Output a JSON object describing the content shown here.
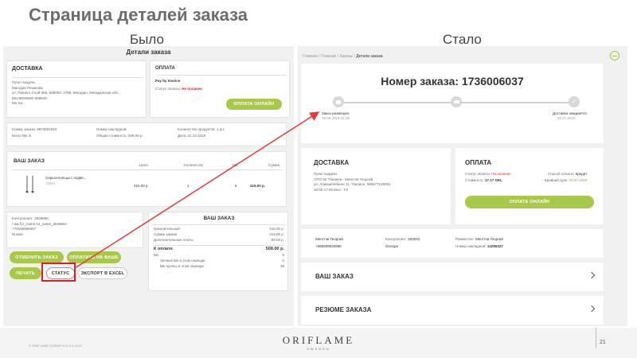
{
  "slide": {
    "title": "Страница деталей заказа",
    "before_label": "Было",
    "after_label": "Стало",
    "page_number": "21",
    "copyright": "© ORIFLAME COSMETICS S.A 2019",
    "logo": "ORIFLAME",
    "logo_sub": "SWEDEN"
  },
  "before": {
    "page_title": "Детали заказа",
    "delivery": {
      "title": "ДОСТАВКА",
      "lines": [
        "Пункт выдачи",
        "Магадан Резанова",
        "ул. Пешего 3 кой-356, 685000, 2768, Магадан, Магаданская обл...",
        "89148006890 898849",
        "Mo-Sa"
      ]
    },
    "payment": {
      "title": "ОПЛАТА",
      "method": "Pay by Invoice",
      "status_label": "Статус оплаты:",
      "status_value": "Не оплачен",
      "pay_button": "ОПЛАТА ОНЛАЙН"
    },
    "summary": {
      "order_no": "Номер заказа: 9973602010",
      "bb": "Всего ББ: 5",
      "invoice": "Номер накладной:",
      "total_cost": "Общая стоимость: 508.00 р.",
      "qty": "Количество продуктов: 1 шт.",
      "date": "Дата: 21.12.2018"
    },
    "your_order": {
      "title": "ВАШ ЗАКАЗ",
      "cols": [
        "Цена",
        "Количество",
        "ББ",
        "Сумма"
      ],
      "item_name": "Серьги-кольца с подве...",
      "item_code": "33851",
      "price": "415.00 р.",
      "qty": "1",
      "bb": "5",
      "sum": "415.00 р."
    },
    "consultant": {
      "lines": [
        "Консультант: 2848866",
        "• ам.fcz_name.txt_name_284866л",
        "+79166666667",
        "Russia"
      ]
    },
    "totals": {
      "title": "ВАШ ЗАКАЗ",
      "rows": [
        [
          "Накопительный",
          "415.00 р."
        ],
        [
          "Сумма заказа",
          "415.00 р."
        ],
        [
          "Дополнительные платы",
          "93.00 р."
        ],
        [
          "К оплате",
          "508.00 р."
        ],
        [
          "ББ",
          "5"
        ],
        [
          "Личные ББ в этом периоде",
          "0"
        ],
        [
          "ББ группы в этом периоде",
          "38"
        ]
      ]
    },
    "buttons": {
      "change": "ОТМЕНИТЬ ЗАКАЗ",
      "pay": "ОПЛАТИТЬ НА ВАШЕ",
      "print": "ПЕЧАТЬ",
      "status": "СТАТУС",
      "export": "ЭКСПОРТ В EXCEL"
    }
  },
  "after": {
    "breadcrumb": [
      "Главная",
      "Главная",
      "Заказы"
    ],
    "breadcrumb_current": "Детали заказа",
    "order_heading": "Номер заказа: 1736006037",
    "timeline": {
      "start_label": "Заказ размещен",
      "start_date": "29.06.2019 21:55",
      "end_label": "Доставка ожидается",
      "end_date": "02.07.2019"
    },
    "delivery": {
      "title": "ДОСТАВКА",
      "lines": [
        "Пункт выдачи",
        "СПО 92 Тбилиси - Менгтов Георгий",
        "ул. Агмашенебели 11, тбилиси, 995577128051",
        "10:00-17:00 Mon - Fri"
      ]
    },
    "payment": {
      "title": "ОПЛАТА",
      "status_label": "Статус оплаты:",
      "status_value": "Не оплачен",
      "cost_label": "Стоимость:",
      "cost_value": "17.17 GEL",
      "method_label": "Способ оплаты:",
      "method_value": "Кредит",
      "deadline_label": "Крайний срок:",
      "deadline_value": "20.07.2019",
      "pay_button": "ОПЛАТА ОНЛАЙН"
    },
    "info": {
      "name1": "Менгтов Георгий",
      "phone": "+995599925958",
      "consultant_label": "Консультант:",
      "consultant_value": "202031",
      "country": "Georgia",
      "placed_label": "Разместил:",
      "placed_value": "Менгтов Георгий",
      "invoice_label": "Номер накладной:",
      "invoice_value": "14295327"
    },
    "your_order": "ВАШ ЗАКАЗ",
    "summary": "РЕЗЮМЕ ЗАКАЗА"
  },
  "colors": {
    "accent": "#a8c84a",
    "red": "#e02020",
    "arrow": "#e53935"
  }
}
